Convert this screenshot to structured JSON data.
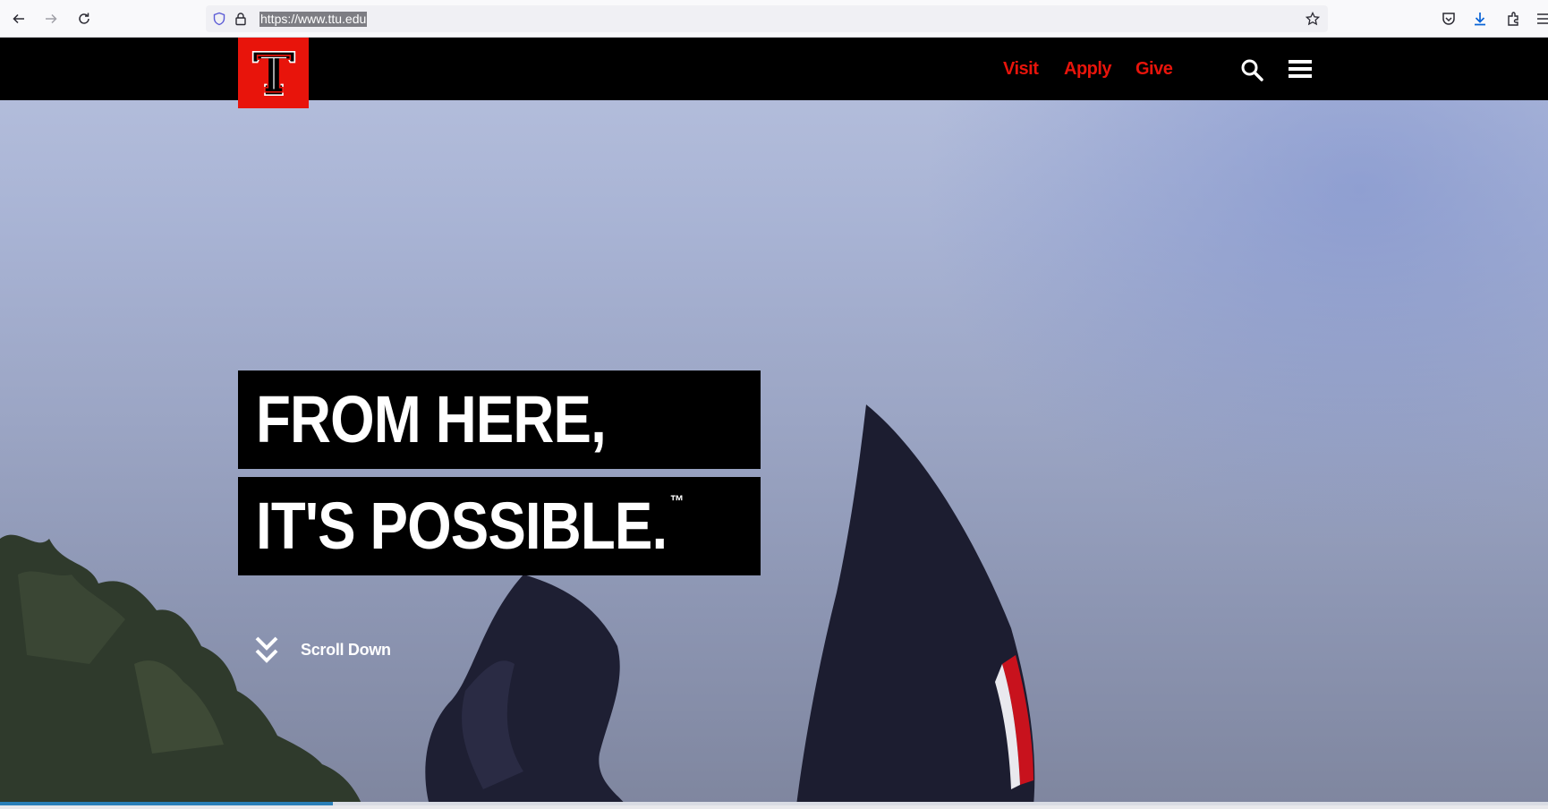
{
  "browser": {
    "url": "https://www.ttu.edu",
    "icons": [
      "back-icon",
      "forward-icon",
      "reload-icon",
      "shield-icon",
      "lock-icon",
      "star-icon",
      "pocket-icon",
      "download-icon",
      "extensions-icon",
      "menu-icon"
    ]
  },
  "header": {
    "logo_alt": "Texas Tech Double T",
    "nav": {
      "visit": "Visit",
      "apply": "Apply",
      "give": "Give"
    },
    "icons": [
      "search-icon",
      "hamburger-icon"
    ]
  },
  "hero": {
    "line1": "FROM HERE,",
    "line2": "IT'S POSSIBLE.",
    "trademark": "™",
    "scroll_label": "Scroll Down"
  },
  "colors": {
    "brand_red": "#e8140b",
    "header_black": "#000000",
    "sky": "#a8b3d4"
  }
}
